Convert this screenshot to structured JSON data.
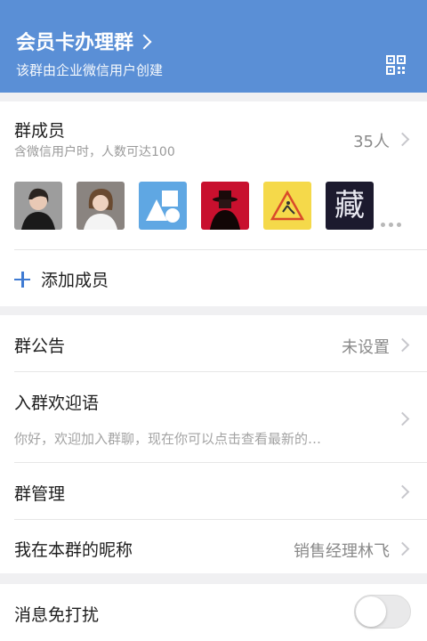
{
  "header": {
    "title": "会员卡办理群",
    "subtitle": "该群由企业微信用户创建",
    "bg_color": "#5a8fd6"
  },
  "members": {
    "title": "群成员",
    "hint": "含微信用户时，人数可达100",
    "count": "35人",
    "avatars": [
      "avatar-woman-1",
      "avatar-woman-2",
      "avatar-shapes",
      "avatar-hat-man",
      "avatar-caution-sign",
      "avatar-calligraphy"
    ],
    "avatar_text": "藏",
    "add_label": "添加成员"
  },
  "announcement": {
    "label": "群公告",
    "value": "未设置"
  },
  "welcome": {
    "label": "入群欢迎语",
    "preview": "你好，欢迎加入群聊，现在你可以点击查看最新的…"
  },
  "management": {
    "label": "群管理"
  },
  "nickname": {
    "label": "我在本群的昵称",
    "value": "销售经理林飞"
  },
  "mute": {
    "label": "消息免打扰",
    "enabled": false
  }
}
